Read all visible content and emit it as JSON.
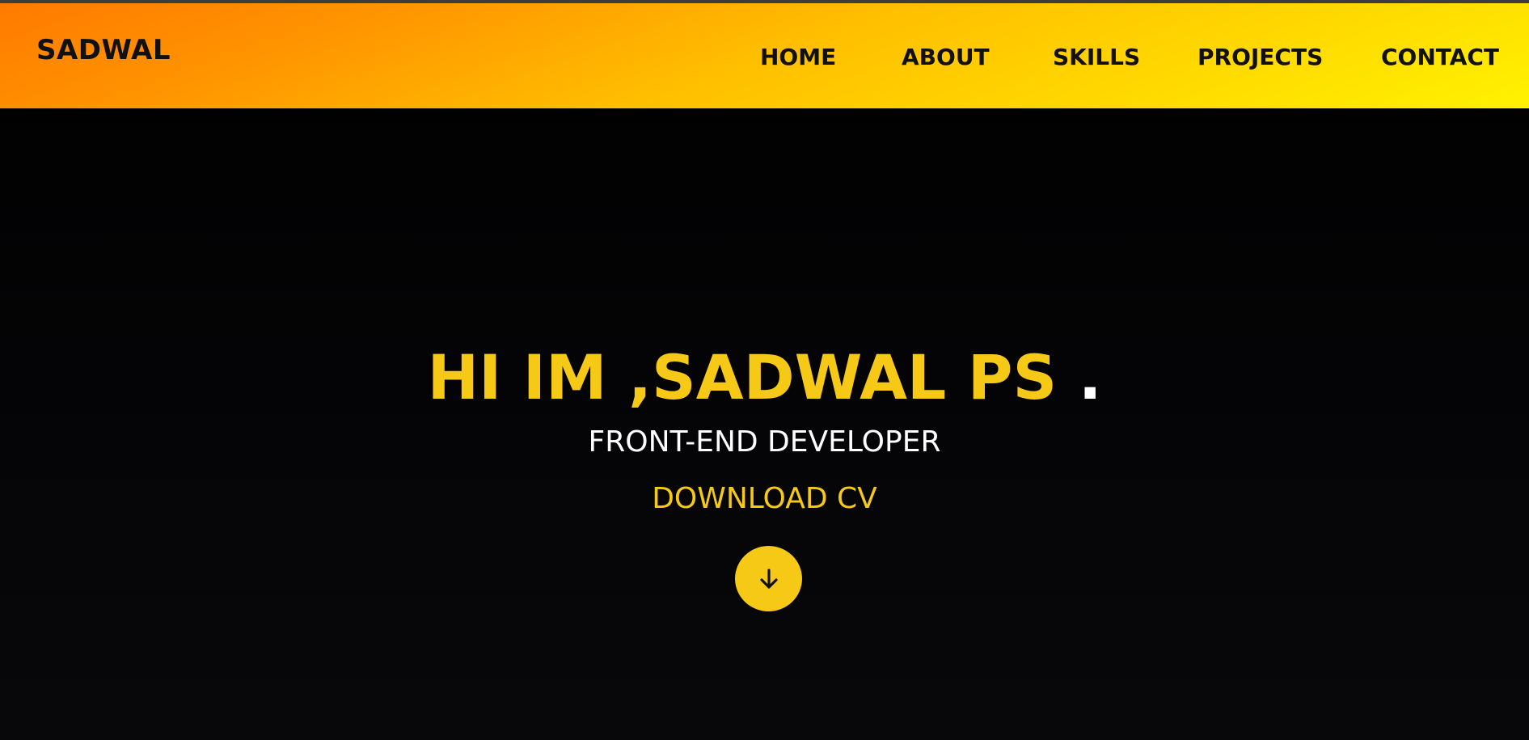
{
  "brand": "SADWAL",
  "nav": {
    "items": [
      {
        "label": "HOME"
      },
      {
        "label": "ABOUT"
      },
      {
        "label": "SKILLS"
      },
      {
        "label": "PROJECTS"
      },
      {
        "label": "CONTACT"
      }
    ]
  },
  "hero": {
    "title_prefix": "HI IM ,SADWAL PS",
    "title_dot": ".",
    "subtitle": "FRONT-END DEVELOPER",
    "cv_label": "DOWNLOAD CV",
    "scroll_icon": "arrow-down-icon"
  },
  "colors": {
    "accent": "#f6c916",
    "nav_gradient_start": "#ff7a00",
    "nav_gradient_end": "#fff200",
    "background": "#000000",
    "text_light": "#ffffff",
    "text_dark": "#111111"
  }
}
